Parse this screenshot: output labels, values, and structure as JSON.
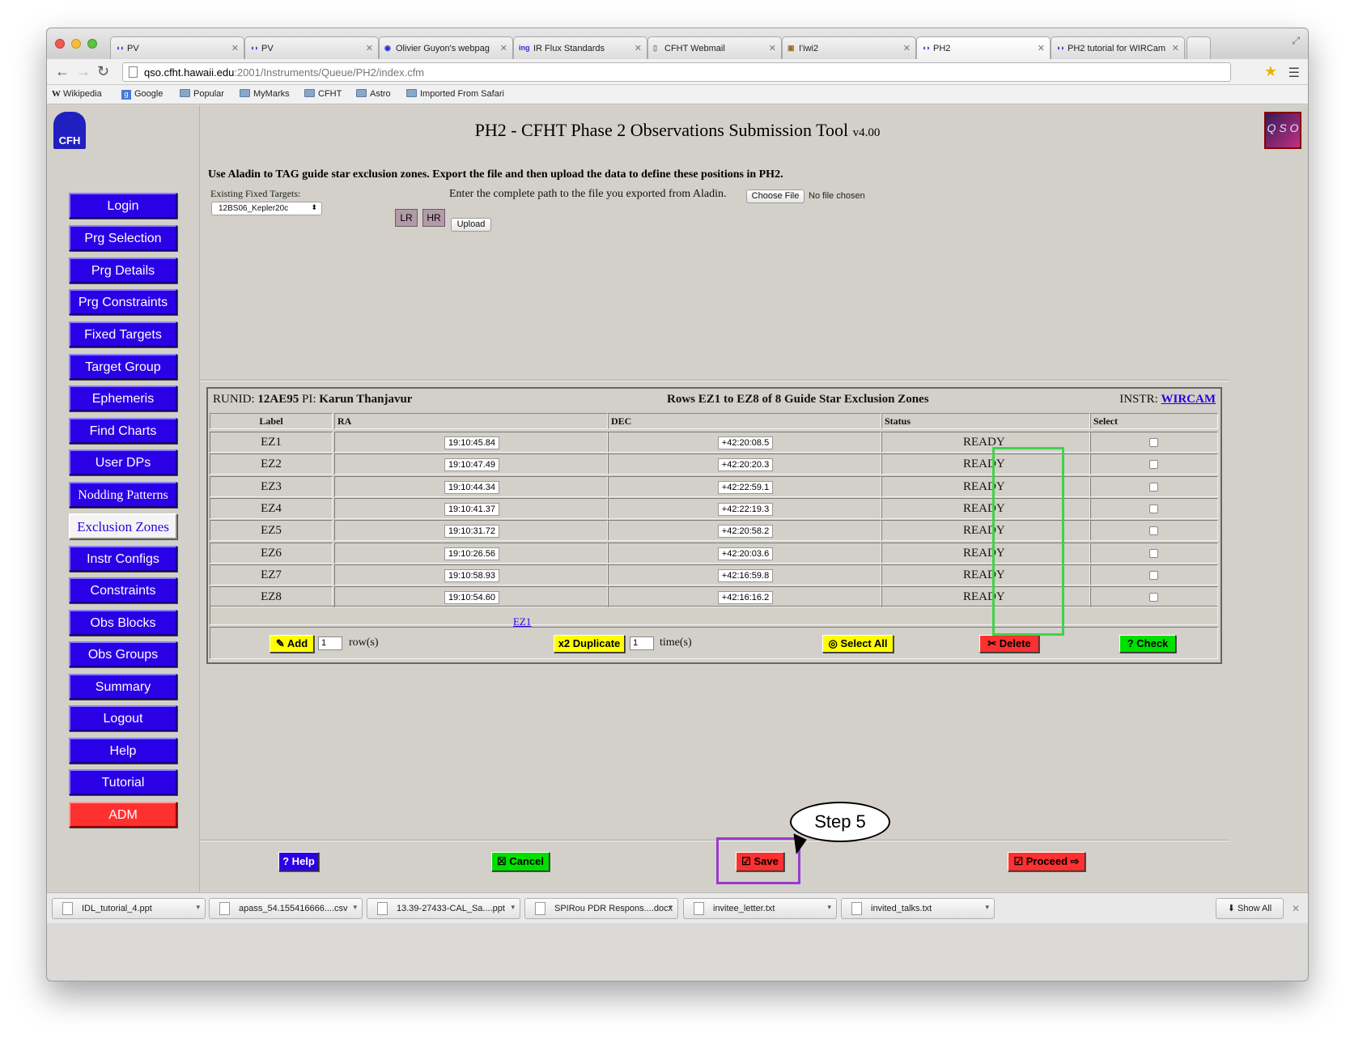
{
  "browser": {
    "tabs": [
      {
        "label": "PV",
        "favicon": "cfht-icon"
      },
      {
        "label": "PV",
        "favicon": "cfht-icon"
      },
      {
        "label": "Olivier Guyon's webpag",
        "favicon": "globe-icon"
      },
      {
        "label": "IR Flux Standards",
        "favicon": "ing-icon"
      },
      {
        "label": "CFHT Webmail",
        "favicon": "page-icon"
      },
      {
        "label": "I'iwi2",
        "favicon": "image-icon"
      },
      {
        "label": "PH2",
        "favicon": "cfht-icon"
      },
      {
        "label": "PH2 tutorial for WIRCam",
        "favicon": "cfht-icon"
      }
    ],
    "url_host": "qso.cfht.hawaii.edu",
    "url_path": ":2001/Instruments/Queue/PH2/index.cfm",
    "bookmarks": [
      "Wikipedia",
      "Google",
      "Popular",
      "MyMarks",
      "CFHT",
      "Astro",
      "Imported From Safari"
    ]
  },
  "page": {
    "title": "PH2 - CFHT Phase 2 Observations Submission Tool",
    "version": "v4.00",
    "logo_left_text": "CFH",
    "logo_right_text": "Q S O"
  },
  "sidebar": [
    {
      "label": "Login"
    },
    {
      "label": "Prg Selection"
    },
    {
      "label": "Prg Details"
    },
    {
      "label": "Prg Constraints"
    },
    {
      "label": "Fixed Targets"
    },
    {
      "label": "Target Group"
    },
    {
      "label": "Ephemeris"
    },
    {
      "label": "Find Charts"
    },
    {
      "label": "User DPs"
    },
    {
      "label": "Nodding Patterns"
    },
    {
      "label": "Exclusion Zones"
    },
    {
      "label": "Instr Configs"
    },
    {
      "label": "Constraints"
    },
    {
      "label": "Obs Blocks"
    },
    {
      "label": "Obs Groups"
    },
    {
      "label": "Summary"
    },
    {
      "label": "Logout"
    },
    {
      "label": "Help"
    },
    {
      "label": "Tutorial"
    },
    {
      "label": "ADM"
    }
  ],
  "upload": {
    "instruction": "Use Aladin to TAG guide star exclusion zones. Export the file and then upload the data to define these positions in PH2.",
    "existing_label": "Existing Fixed Targets:",
    "existing_value": "12BS06_Kepler20c",
    "lr_label": "LR",
    "hr_label": "HR",
    "path_label": "Enter the complete path to the file you exported from Aladin.",
    "choose_file": "Choose File",
    "no_file": "No file chosen",
    "upload_label": "Upload"
  },
  "table": {
    "runid_label": "RUNID:",
    "runid": "12AE95",
    "pi_label": "PI:",
    "pi": "Karun Thanjavur",
    "rows_info": "Rows EZ1 to EZ8 of 8 Guide Star Exclusion Zones",
    "instr_label": "INSTR:",
    "instr": "WIRCAM",
    "headers": {
      "label": "Label",
      "ra": "RA",
      "dec": "DEC",
      "status": "Status",
      "select": "Select"
    },
    "rows": [
      {
        "label": "EZ1",
        "ra": "19:10:45.84",
        "dec": "+42:20:08.5",
        "status": "READY"
      },
      {
        "label": "EZ2",
        "ra": "19:10:47.49",
        "dec": "+42:20:20.3",
        "status": "READY"
      },
      {
        "label": "EZ3",
        "ra": "19:10:44.34",
        "dec": "+42:22:59.1",
        "status": "READY"
      },
      {
        "label": "EZ4",
        "ra": "19:10:41.37",
        "dec": "+42:22:19.3",
        "status": "READY"
      },
      {
        "label": "EZ5",
        "ra": "19:10:31.72",
        "dec": "+42:20:58.2",
        "status": "READY"
      },
      {
        "label": "EZ6",
        "ra": "19:10:26.56",
        "dec": "+42:20:03.6",
        "status": "READY"
      },
      {
        "label": "EZ7",
        "ra": "19:10:58.93",
        "dec": "+42:16:59.8",
        "status": "READY"
      },
      {
        "label": "EZ8",
        "ra": "19:10:54.60",
        "dec": "+42:16:16.2",
        "status": "READY"
      }
    ],
    "page_link": "EZ1",
    "add_label": "Add",
    "add_count": "1",
    "rows_suffix": "row(s)",
    "duplicate_label": "x2 Duplicate",
    "duplicate_count": "1",
    "times_suffix": "time(s)",
    "select_all_label": "Select All",
    "delete_label": "Delete",
    "check_label": "? Check"
  },
  "bottom": {
    "help": "? Help",
    "cancel": "Cancel",
    "save": "Save",
    "proceed": "Proceed"
  },
  "annotation": {
    "bubble": "Step 5",
    "green_box_color": "#3fd34a",
    "purple_box_color": "#9a3acd"
  },
  "downloads": [
    "IDL_tutorial_4.ppt",
    "apass_54.155416666....csv",
    "13.39-27433-CAL_Sa....ppt",
    "SPIRou PDR Respons....docx",
    "invitee_letter.txt",
    "invited_talks.txt"
  ],
  "show_all": "Show All"
}
